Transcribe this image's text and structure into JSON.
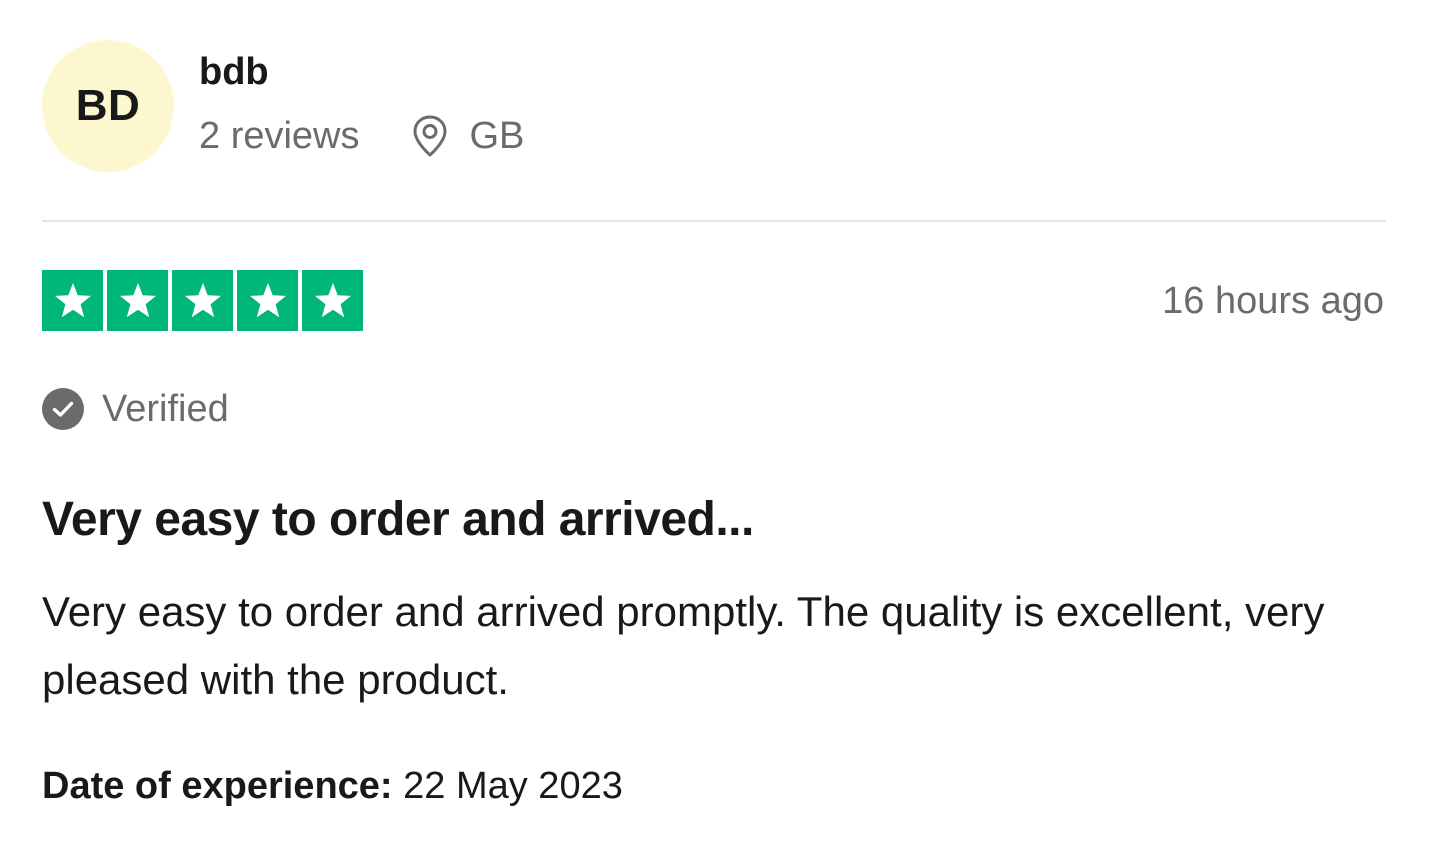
{
  "consumer": {
    "initials": "BD",
    "name": "bdb",
    "review_count": "2 reviews",
    "country": "GB",
    "avatar_color": "#fdf7cf",
    "location_icon": "location-pin-icon"
  },
  "review": {
    "rating": 5,
    "max_rating": 5,
    "star_color": "#00b67a",
    "time_ago": "16 hours ago",
    "verified_label": "Verified",
    "verified_icon": "check-circle-icon",
    "title": "Very easy to order and arrived...",
    "body": "Very easy to order and arrived promptly. The quality is excellent, very pleased with the product.",
    "experience_label": "Date of experience:",
    "experience_date": "22 May 2023"
  }
}
